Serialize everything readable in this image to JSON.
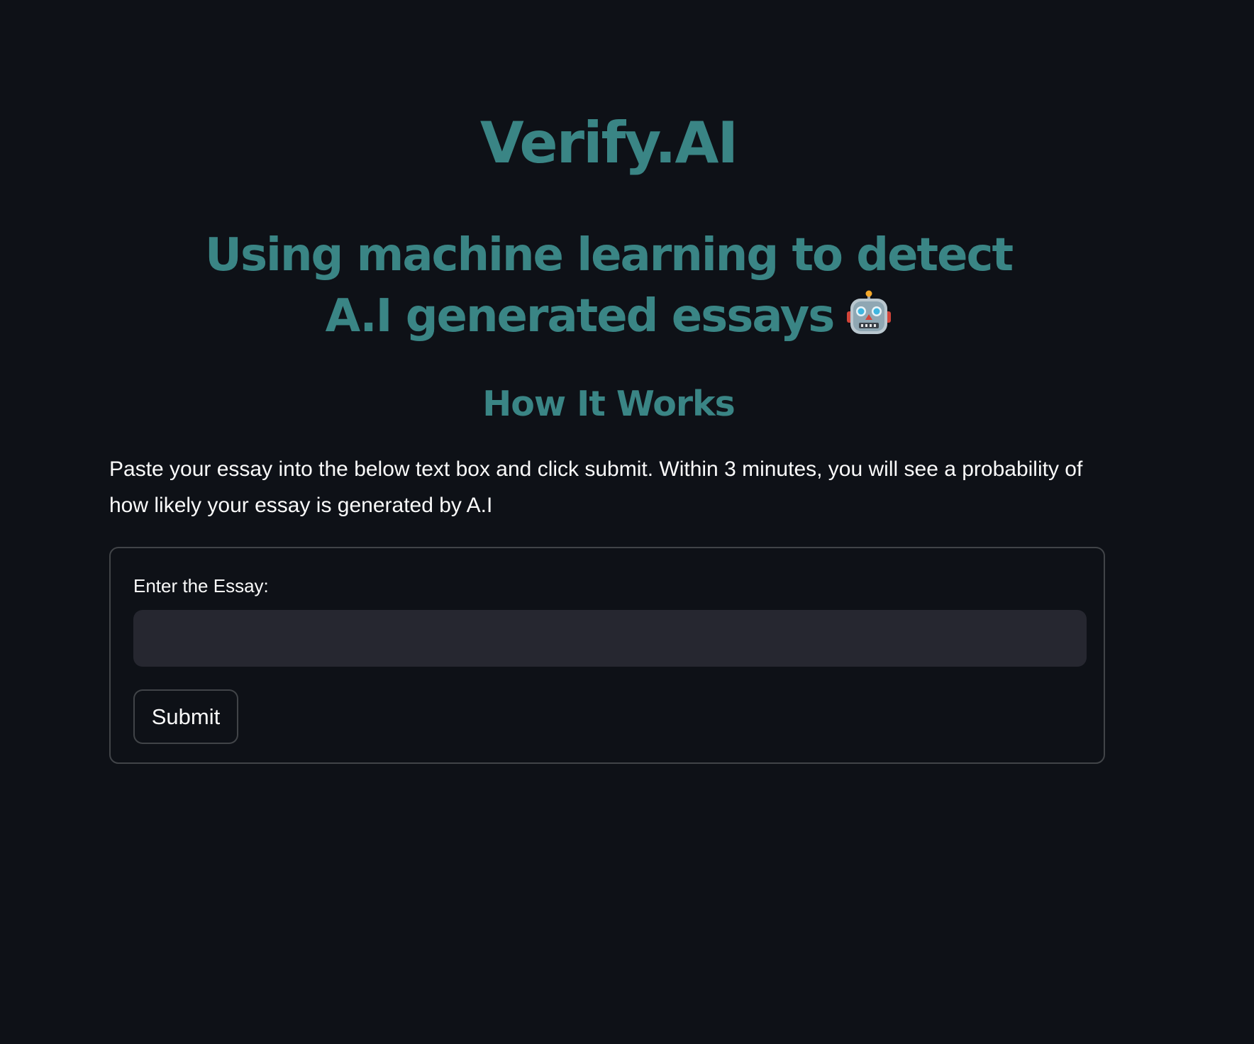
{
  "theme": {
    "heading_color": "#3a8585",
    "background": "#0e1117",
    "text_color": "#fafafa"
  },
  "header": {
    "title": "Verify.AI",
    "subtitle": "Using machine learning to detect A.I generated essays",
    "subtitle_icon": "robot-face-icon"
  },
  "how_it_works": {
    "heading": "How It Works",
    "description": "Paste your essay into the below text box and click submit. Within 3 minutes, you will see a probability of how likely your essay is generated by A.I"
  },
  "form": {
    "essay_label": "Enter the Essay:",
    "essay_value": "",
    "submit_label": "Submit"
  }
}
